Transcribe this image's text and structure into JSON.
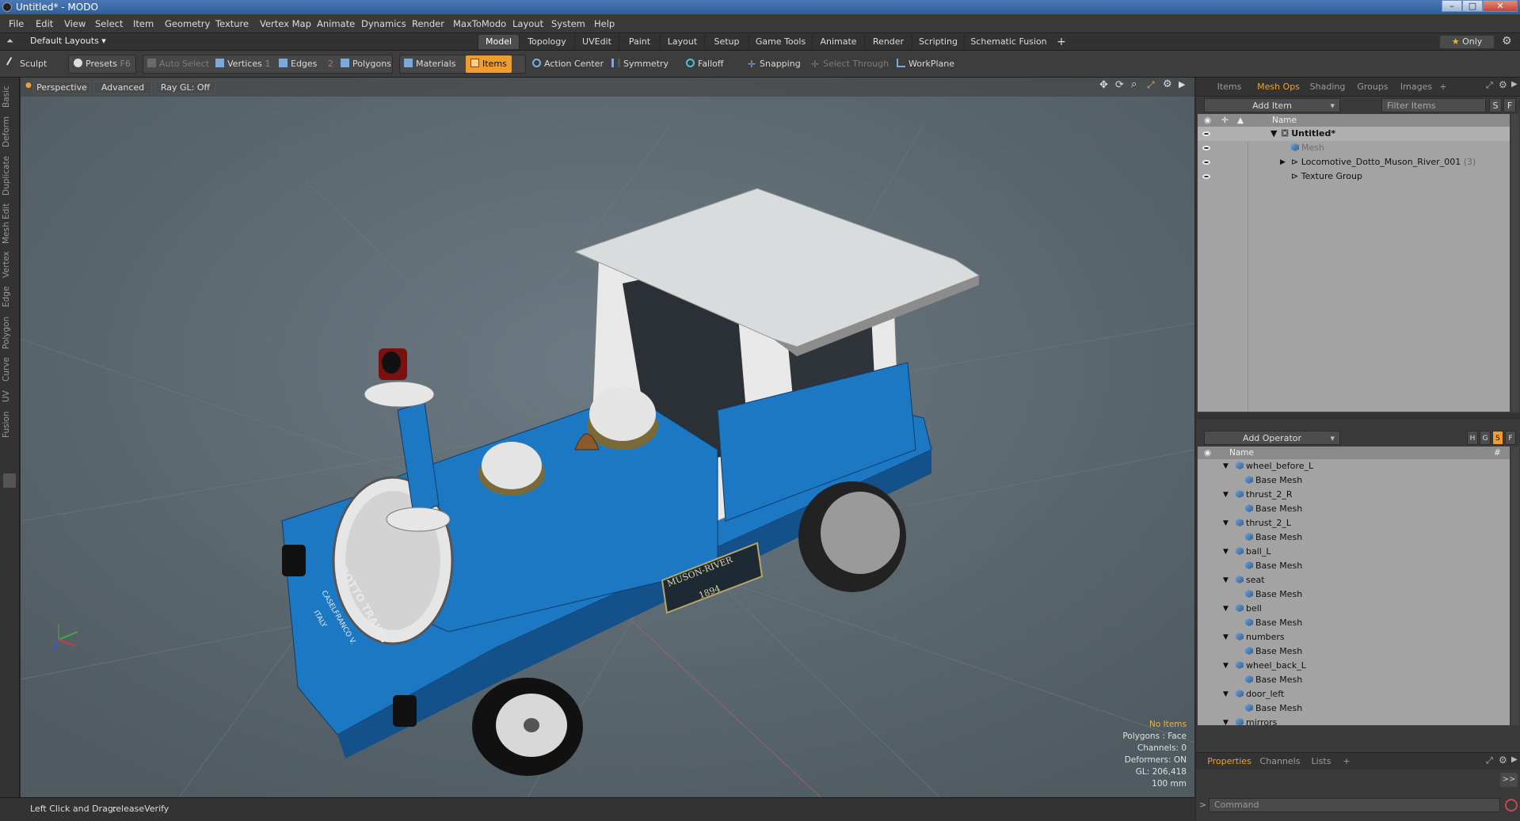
{
  "window": {
    "title": "Untitled* - MODO",
    "buttons": [
      "–",
      "□",
      "✕"
    ]
  },
  "menubar": {
    "items": [
      "File",
      "Edit",
      "View",
      "Select",
      "Item",
      "Geometry",
      "Texture",
      "Vertex Map",
      "Animate",
      "Dynamics",
      "Render",
      "MaxToModo",
      "Layout",
      "System",
      "Help"
    ]
  },
  "layoutbar": {
    "layout_select": "Default Layouts ▾",
    "tabs": [
      "Model",
      "Topology",
      "UVEdit",
      "Paint",
      "Layout",
      "Setup",
      "Game Tools",
      "Animate",
      "Render",
      "Scripting",
      "Schematic Fusion"
    ],
    "active_tab": "Model",
    "add_tab": "+",
    "only_label": "Only"
  },
  "toolbar": {
    "sculpt": "Sculpt",
    "presets": "Presets",
    "presets_key": "F6",
    "auto_select": "Auto Select",
    "vertices": "Vertices",
    "vertices_count": "1",
    "edges": "Edges",
    "edges_count": "2",
    "polygons": "Polygons",
    "materials": "Materials",
    "items": "Items",
    "action_center": "Action Center",
    "symmetry": "Symmetry",
    "falloff": "Falloff",
    "snapping": "Snapping",
    "select_through": "Select Through",
    "workplane": "WorkPlane"
  },
  "left_tabs": [
    "Basic",
    "Deform",
    "Duplicate",
    "Mesh Edit",
    "Vertex",
    "Edge",
    "Polygon",
    "Curve",
    "UV",
    "Fusion"
  ],
  "viewport": {
    "view_mode": "Perspective",
    "advanced": "Advanced",
    "raygl": "Ray GL: Off",
    "stats": {
      "no_items": "No Items",
      "polygons": "Polygons : Face",
      "channels": "Channels: 0",
      "deformers": "Deformers: ON",
      "gl": "GL: 206,418",
      "scale": "100 mm"
    },
    "sign_line1": "MUSON-RIVER",
    "sign_line2": "1894",
    "side_text": "DOTTO TRAINS",
    "side_text2": "CASELFRANCO V.",
    "side_text3": "ITALY"
  },
  "statusbar": {
    "hint_label": "Left Click and Drag:",
    "hint_value": "releaseVerify"
  },
  "right_panel": {
    "top_tabs": [
      "Items",
      "Mesh Ops",
      "Shading",
      "Groups",
      "Images",
      "+"
    ],
    "active_top_tab": "Mesh Ops",
    "add_item": "Add Item",
    "filter_items": "Filter Items",
    "filter_s": "S",
    "filter_f": "F",
    "name_header": "Name",
    "scene": [
      {
        "label": "Untitled*",
        "bold": true,
        "indent": 0,
        "arrow": "▼"
      },
      {
        "label": "Mesh",
        "dim": true,
        "indent": 1,
        "arrow": ""
      },
      {
        "label": "Locomotive_Dotto_Muson_River_001",
        "count": "(3)",
        "indent": 1,
        "arrow": "▶"
      },
      {
        "label": "Texture Group",
        "indent": 1,
        "arrow": ""
      }
    ],
    "add_operator": "Add Operator",
    "op_flags": [
      "H",
      "G",
      "S",
      "F"
    ],
    "op_name_header": "Name",
    "op_hash": "#",
    "operators": [
      {
        "name": "wheel_before_L",
        "child": "Base Mesh"
      },
      {
        "name": "thrust_2_R",
        "child": "Base Mesh"
      },
      {
        "name": "thrust_2_L",
        "child": "Base Mesh"
      },
      {
        "name": "ball_L",
        "child": "Base Mesh"
      },
      {
        "name": "seat",
        "child": "Base Mesh"
      },
      {
        "name": "bell",
        "child": "Base Mesh"
      },
      {
        "name": "numbers",
        "child": "Base Mesh"
      },
      {
        "name": "wheel_back_L",
        "child": "Base Mesh"
      },
      {
        "name": "door_left",
        "child": "Base Mesh"
      },
      {
        "name": "mirrors",
        "child": ""
      }
    ],
    "bottom_tabs": [
      "Properties",
      "Channels",
      "Lists",
      "+"
    ],
    "active_bottom_tab": "Properties",
    "expand": ">>",
    "command_placeholder": "Command"
  },
  "colors": {
    "accent": "#f29d2b",
    "viewport_bg": "#5c6870",
    "train_blue": "#1f7fcf"
  }
}
